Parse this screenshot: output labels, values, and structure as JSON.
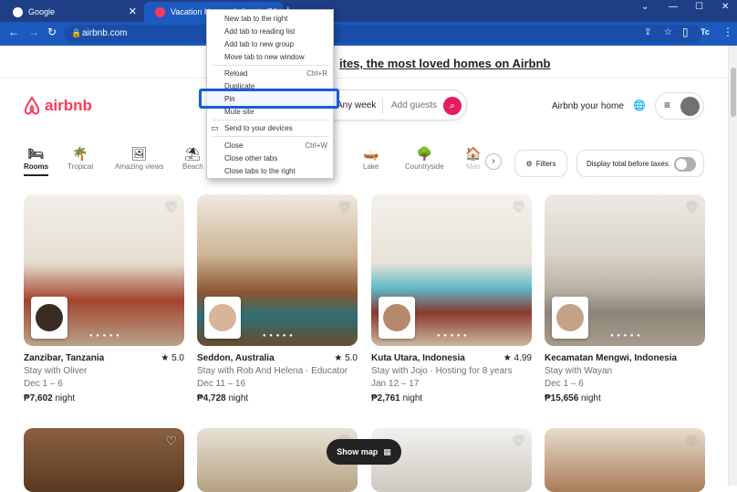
{
  "browser": {
    "tabs": [
      {
        "title": "Google",
        "close": "✕"
      },
      {
        "title": "Vacation Homes & Condo Rent",
        "close": "✕"
      }
    ],
    "url": "airbnb.com",
    "window_controls": [
      "⌄",
      "—",
      "☐",
      "✕"
    ],
    "profile_initials": "Tc"
  },
  "context_menu": {
    "items": [
      {
        "label": "New tab to the right",
        "shortcut": ""
      },
      {
        "label": "Add tab to reading list",
        "shortcut": ""
      },
      {
        "label": "Add tab to new group",
        "shortcut": ""
      },
      {
        "label": "Move tab to new window",
        "shortcut": ""
      },
      {
        "label": "Reload",
        "shortcut": "Ctrl+R"
      },
      {
        "label": "Duplicate",
        "shortcut": ""
      },
      {
        "label": "Pin",
        "shortcut": ""
      },
      {
        "label": "Mute site",
        "shortcut": ""
      },
      {
        "label": "Send to your devices",
        "shortcut": ""
      },
      {
        "label": "Close",
        "shortcut": "Ctrl+W"
      },
      {
        "label": "Close other tabs",
        "shortcut": ""
      },
      {
        "label": "Close tabs to the right",
        "shortcut": ""
      }
    ],
    "highlighted": "Pin"
  },
  "banner": {
    "text": "ites, the most loved homes on Airbnb"
  },
  "header": {
    "logo": "airbnb",
    "search_week": "Any week",
    "search_guests": "Add guests",
    "host_link": "Airbnb your home"
  },
  "categories": [
    {
      "label": "Rooms",
      "icon": "🛏",
      "active": true
    },
    {
      "label": "Tropical",
      "icon": "🌴",
      "active": false
    },
    {
      "label": "Amazing views",
      "icon": "🖼",
      "active": false
    },
    {
      "label": "Beach",
      "icon": "⛱",
      "active": false
    },
    {
      "label": "Lake",
      "icon": "🛶",
      "active": false
    },
    {
      "label": "Countryside",
      "icon": "🌳",
      "active": false
    },
    {
      "label": "Man",
      "icon": "🏠",
      "active": false
    }
  ],
  "filters_label": "Filters",
  "taxes_label": "Display total before taxes",
  "listings": [
    {
      "location": "Zanzibar, Tanzania",
      "rating": "★ 5.0",
      "host": "Stay with Oliver",
      "dates": "Dec 1 – 6",
      "price": "₱7,602",
      "unit": "night",
      "color": "#b5a585"
    },
    {
      "location": "Seddon, Australia",
      "rating": "★ 5.0",
      "host": "Stay with Rob And Helena · Educator",
      "dates": "Dec 11 – 16",
      "price": "₱4,728",
      "unit": "night",
      "color": "#9a6a45"
    },
    {
      "location": "Kuta Utara, Indonesia",
      "rating": "★ 4.99",
      "host": "Stay with Jojo · Hosting for 8 years",
      "dates": "Jan 12 – 17",
      "price": "₱2,761",
      "unit": "night",
      "color": "#c7b9a3"
    },
    {
      "location": "Kecamatan Mengwi, Indonesia",
      "rating": "",
      "host": "Stay with Wayan",
      "dates": "Dec 1 – 6",
      "price": "₱15,656",
      "unit": "night",
      "color": "#a7a29a"
    }
  ],
  "second_row_colors": [
    "#7a5535",
    "#c9b59a",
    "#d8d5cf",
    "#b88e6a"
  ],
  "show_map": "Show map"
}
